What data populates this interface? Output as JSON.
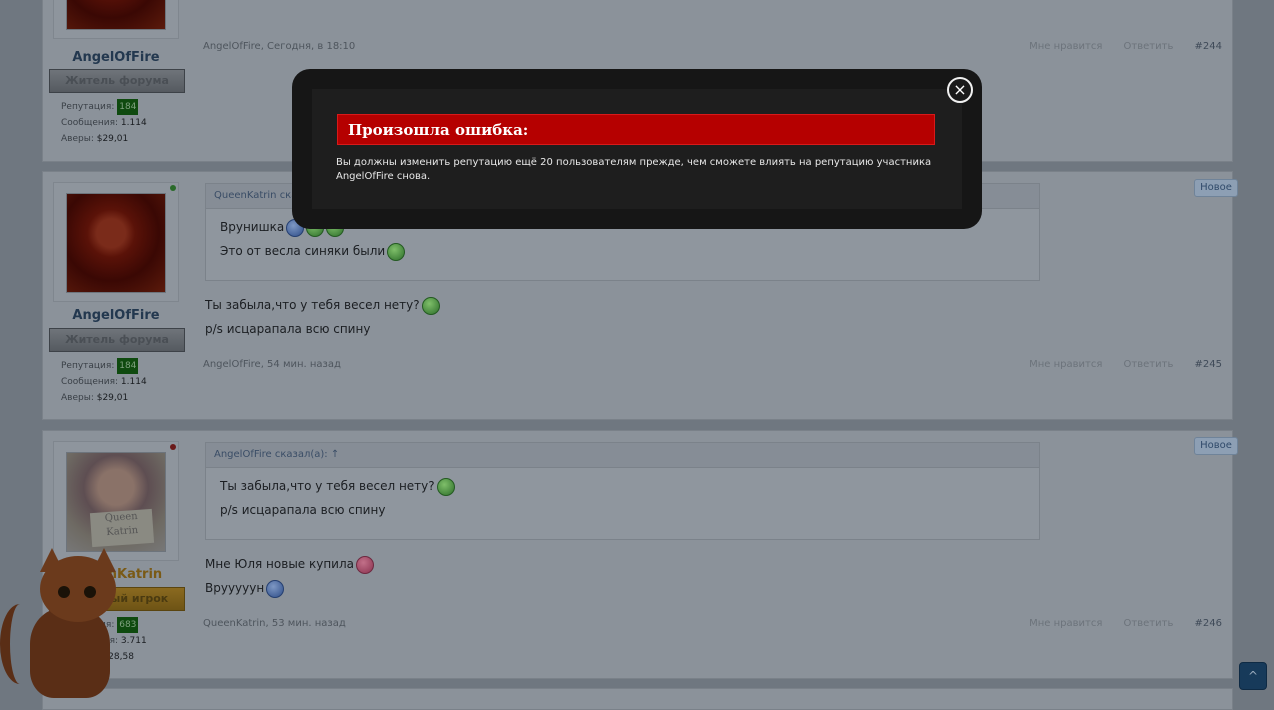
{
  "modal": {
    "title": "Произошла ошибка:",
    "message": "Вы должны изменить репутацию ещё 20 пользователям прежде, чем сможете влиять на репутацию участника AngelOfFire снова.",
    "close_icon": "×"
  },
  "labels": {
    "rep": "Репутация:",
    "msgs": "Сообщения:",
    "avery": "Аверы:",
    "like": "Мне нравится",
    "reply": "Ответить",
    "new_badge": "Новое",
    "scroll_top_icon": "^"
  },
  "posts": [
    {
      "user": "AngelOfFire",
      "rank": "Житель форума",
      "reputation": "184",
      "messages": "1.114",
      "avery": "$29,01",
      "meta": "AngelOfFire, Сегодня, в 18:10",
      "number": "#244"
    },
    {
      "user": "AngelOfFire",
      "rank": "Житель форума",
      "reputation": "184",
      "messages": "1.114",
      "avery": "$29,01",
      "quote_author": "QueenKatrin сказал(а): ↑",
      "quote_lines": [
        "Врунишка",
        "Это от весла синяки были"
      ],
      "lines": [
        "Ты забыла,что у тебя весел нету?",
        "p/s исцарапала всю спину"
      ],
      "meta": "AngelOfFire, 54 мин. назад",
      "number": "#245"
    },
    {
      "user": "QueenKatrin",
      "rank": "Активный игрок",
      "reputation": "683",
      "messages": "3.711",
      "avery": "$228,58",
      "avatar_sign": "Queen Katrin",
      "quote_author": "AngelOfFire сказал(а): ↑",
      "quote_lines": [
        "Ты забыла,что у тебя весел нету?",
        "p/s исцарапала всю спину"
      ],
      "lines": [
        "Мне Юля новые купила",
        "Врууууун"
      ],
      "meta": "QueenKatrin, 53 мин. назад",
      "number": "#246"
    }
  ],
  "colors": {
    "modal_title_bg": "#b50000",
    "overlay": "#6f7780"
  }
}
